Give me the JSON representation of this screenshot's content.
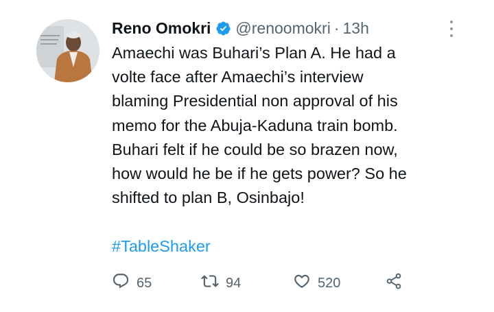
{
  "tweet": {
    "author_name": "Reno Omokri",
    "handle": "@renoomokri",
    "separator": "·",
    "time": "13h",
    "text_lines": [
      "Amaechi was Buhari’s Plan A. He had a",
      "volte face after Amaechi’s interview",
      "blaming Presidential non approval of his",
      "memo for the Abuja-Kaduna train bomb.",
      "Buhari felt if he could be so brazen now,",
      "how would he be if he gets power? So he",
      "shifted to plan B, Osinbajo!"
    ],
    "hashtag": "#TableShaker",
    "replies": "65",
    "retweets": "94",
    "likes": "520"
  },
  "colors": {
    "accent": "#1d9bf0",
    "text": "#0f1419",
    "muted": "#536471"
  },
  "icons": {
    "verified": "verified-badge-icon",
    "more": "more-options-icon",
    "reply": "reply-icon",
    "retweet": "retweet-icon",
    "like": "heart-icon",
    "share": "share-icon"
  }
}
